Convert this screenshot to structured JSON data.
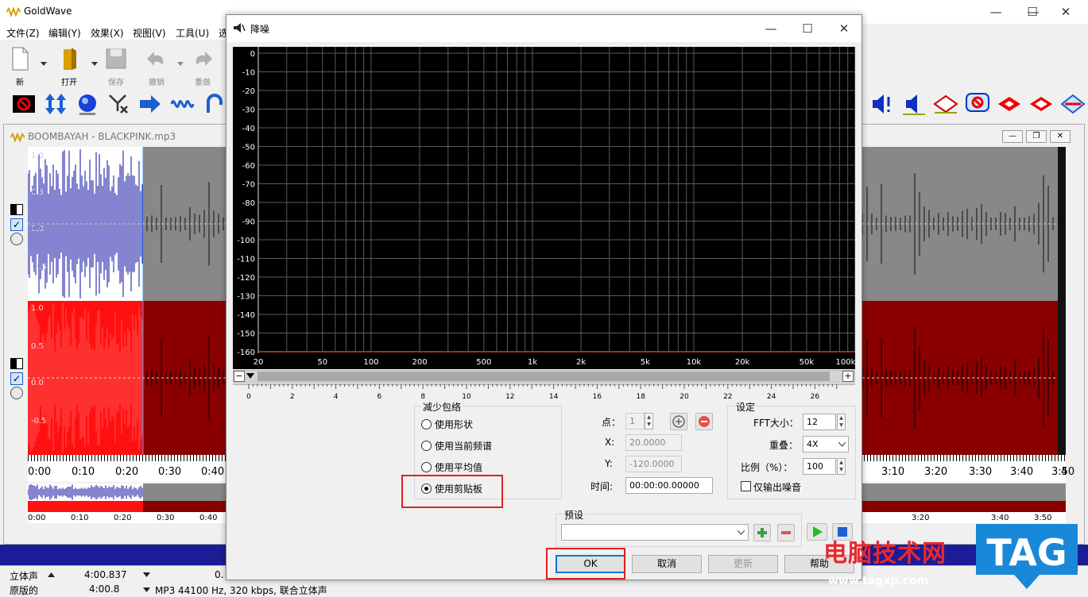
{
  "app": {
    "title": "GoldWave",
    "window_controls": {
      "minimize": "—",
      "maximize": "☐",
      "close": "✕"
    }
  },
  "menu": [
    "文件(Z)",
    "编辑(Y)",
    "效果(X)",
    "视图(V)",
    "工具(U)",
    "选"
  ],
  "toolbar": [
    {
      "label": "新",
      "enabled": true
    },
    {
      "label": "打开",
      "enabled": true
    },
    {
      "label": "保存",
      "enabled": false
    },
    {
      "label": "撤销",
      "enabled": false
    },
    {
      "label": "重做",
      "enabled": false
    }
  ],
  "document": {
    "title": "BOOMBAYAH - BLACKPINK.mp3",
    "controls": {
      "minimize": "—",
      "restore": "❐",
      "close": "✕"
    },
    "amplitude_labels": [
      "1.0",
      "0.5",
      "0.0",
      "-0.5",
      "1.0",
      "0.5",
      "0.0",
      "-0.5"
    ],
    "timeline_left": [
      "0:00",
      "0:10",
      "0:20",
      "0:30",
      "0:40"
    ],
    "timeline_right": [
      "3:10",
      "3:20",
      "3:30",
      "3:40",
      "3:50",
      "4"
    ],
    "overview_left": [
      "0:00",
      "0:10",
      "0:20",
      "0:30",
      "0:40"
    ],
    "overview_right": [
      "3:20",
      "3:40",
      "3:50"
    ]
  },
  "status": {
    "channel": "立体声",
    "duration": "4:00.837",
    "zero": "0.",
    "original": "原版的",
    "orig_duration": "4:00.8",
    "format": "MP3 44100 Hz, 320 kbps, 联合立体声"
  },
  "dialog": {
    "title": "降噪",
    "controls": {
      "minimize": "—",
      "maximize": "☐",
      "close": "✕"
    },
    "y_labels": [
      "0",
      "-10",
      "-20",
      "-30",
      "-40",
      "-50",
      "-60",
      "-70",
      "-80",
      "-90",
      "-100",
      "-110",
      "-120",
      "-130",
      "-140",
      "-150",
      "-160"
    ],
    "x_labels": [
      "20",
      "50",
      "100",
      "200",
      "500",
      "1k",
      "2k",
      "5k",
      "10k",
      "20k",
      "50k",
      "100k"
    ],
    "scroll": {
      "minus": "−",
      "plus": "+"
    },
    "ruler": [
      "0",
      "2",
      "4",
      "6",
      "8",
      "10",
      "12",
      "14",
      "16",
      "18",
      "20",
      "22",
      "24",
      "26"
    ],
    "envelope": {
      "title": "减少包络",
      "options": [
        "使用形状",
        "使用当前频谱",
        "使用平均值",
        "使用剪贴板"
      ],
      "selected_index": 3
    },
    "point": {
      "label": "点：",
      "value": "1",
      "x_label": "X:",
      "x_value": "20.0000",
      "y_label": "Y:",
      "y_value": "-120.0000",
      "time_label": "时间:",
      "time_value": "00:00:00.00000"
    },
    "settings": {
      "title": "设定",
      "fft_label": "FFT大小：",
      "fft_value": "12",
      "overlap_label": "重叠：",
      "overlap_value": "4X",
      "scale_label": "比例（%）：",
      "scale_value": "100",
      "noise_only_label": "仅输出噪音"
    },
    "preset": {
      "title": "预设",
      "value": ""
    },
    "buttons": {
      "ok": "OK",
      "cancel": "取消",
      "update": "更新",
      "help": "帮助"
    }
  },
  "watermark": {
    "text": "电脑技术网",
    "url": "www.tagxp.com",
    "tag": "TAG"
  },
  "colors": {
    "graph_bg": "#000000",
    "grid": "#5a5a5a",
    "curve": "#d04020",
    "wave_top": "#0a0aa0",
    "wave_bottom": "#ff1010",
    "wave_dim_bottom": "#8a0000",
    "wave_dim_top": "#888888"
  }
}
